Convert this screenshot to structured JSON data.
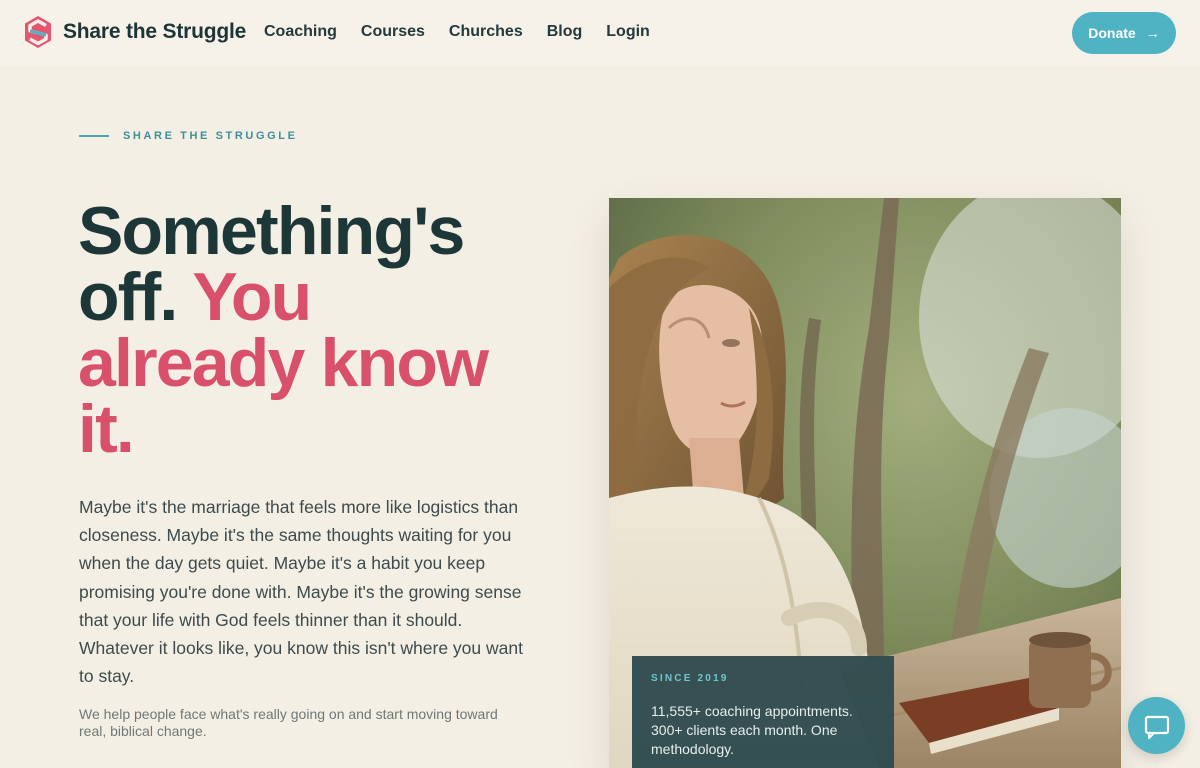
{
  "nav": {
    "brand": "Share the Struggle",
    "links": [
      "Coaching",
      "Courses",
      "Churches",
      "Blog",
      "Login"
    ],
    "donate_label": "Donate",
    "donate_icon": "arrow-right-icon"
  },
  "hero": {
    "eyebrow": "SHARE THE STRUGGLE",
    "headline_part1": "Something's off.",
    "headline_part2": "You already know it.",
    "body": "Maybe it's the marriage that feels more like logistics than closeness. Maybe it's the same thoughts waiting for you when the day gets quiet. Maybe it's a habit you keep promising you're done with. Maybe it's the growing sense that your life with God feels thinner than it should. Whatever it looks like, you know this isn't where you want to stay.",
    "sub": "We help people face what's really going on and start moving toward real, biblical change."
  },
  "stats": {
    "eyebrow": "SINCE 2019",
    "text": "11,555+ coaching appointments. 300+ clients each month. One methodology."
  },
  "chat": {
    "icon": "chat-bubble-icon"
  },
  "colors": {
    "background": "#f4efe4",
    "accent_pink": "#d9506b",
    "teal": "#4fb3c3",
    "dark": "#1d3638",
    "card": "#2f4b4f"
  }
}
